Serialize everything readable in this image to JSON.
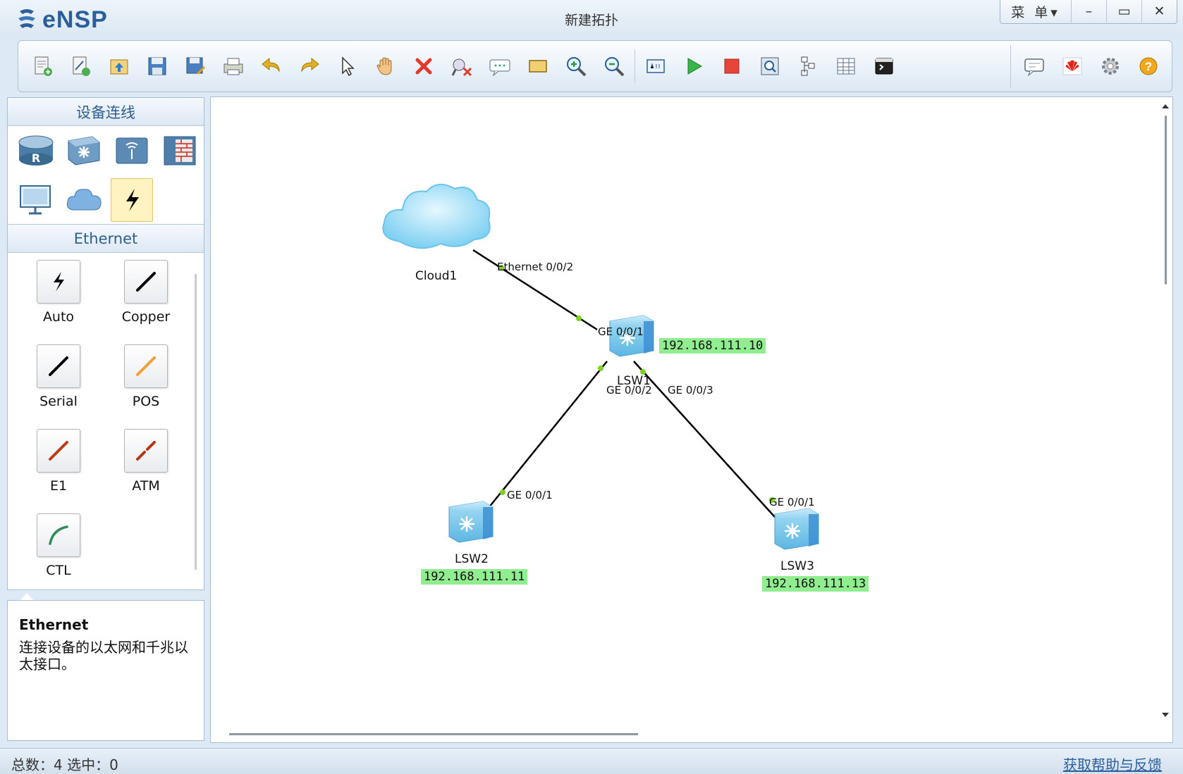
{
  "app": {
    "name": "eNSP",
    "window_title": "新建拓扑",
    "menu_label": "菜 单▾",
    "minimize": "–",
    "maximize": "▭",
    "close": "✕"
  },
  "toolbar": {
    "icons": [
      "new-topology-icon",
      "new-example-icon",
      "open-icon",
      "save-icon",
      "save-as-icon",
      "print-icon",
      "undo-icon",
      "redo-icon",
      "select-icon",
      "pan-icon",
      "delete-icon",
      "delete-link-icon",
      "text-note-icon",
      "rectangle-icon",
      "zoom-in-icon",
      "zoom-out-icon",
      "fit-window-icon",
      "start-device-icon",
      "stop-device-icon",
      "capture-icon",
      "topology-icon",
      "grid-icon",
      "console-icon"
    ],
    "right_icons": [
      "chat-icon",
      "huawei-icon",
      "settings-icon",
      "help-icon"
    ]
  },
  "left_panel": {
    "device_header": "设备连线",
    "devices": [
      {
        "name": "router",
        "icon": "router-icon"
      },
      {
        "name": "switch",
        "icon": "switch-icon"
      },
      {
        "name": "wlan",
        "icon": "wireless-icon"
      },
      {
        "name": "firewall",
        "icon": "firewall-icon"
      },
      {
        "name": "pc",
        "icon": "pc-icon"
      },
      {
        "name": "cloud",
        "icon": "cloud-icon"
      },
      {
        "name": "cable",
        "icon": "cable-icon",
        "selected": true
      }
    ],
    "cable_header": "Ethernet",
    "cables": [
      {
        "label": "Auto",
        "color": "#000000"
      },
      {
        "label": "Copper",
        "color": "#000000"
      },
      {
        "label": "Serial",
        "color": "#000000"
      },
      {
        "label": "POS",
        "color": "#f5a030"
      },
      {
        "label": "E1",
        "color": "#c0391b"
      },
      {
        "label": "ATM",
        "color": "#b53416"
      },
      {
        "label": "CTL",
        "color": "#2e8b57"
      }
    ]
  },
  "description": {
    "title": "Ethernet",
    "text": "连接设备的以太网和千兆以太接口。"
  },
  "topology": {
    "devices": {
      "cloud1": {
        "label": "Cloud1"
      },
      "lsw1": {
        "label": "LSW1",
        "ip": "192.168.111.10"
      },
      "lsw2": {
        "label": "LSW2",
        "ip": "192.168.111.11"
      },
      "lsw3": {
        "label": "LSW3",
        "ip": "192.168.111.13"
      }
    },
    "ports": {
      "cloud1_eth": "Ethernet 0/0/2",
      "lsw1_ge1": "GE 0/0/1",
      "lsw1_ge2": "GE 0/0/2",
      "lsw1_ge3": "GE 0/0/3",
      "lsw2_ge1": "GE 0/0/1",
      "lsw3_ge1": "GE 0/0/1"
    },
    "link_color": "#000000",
    "port_dot_color": "#7ed321",
    "ip_bg_color": "#90ee90"
  },
  "statusbar": {
    "summary": "总数：4 选中：0",
    "help_link": "获取帮助与反馈"
  }
}
